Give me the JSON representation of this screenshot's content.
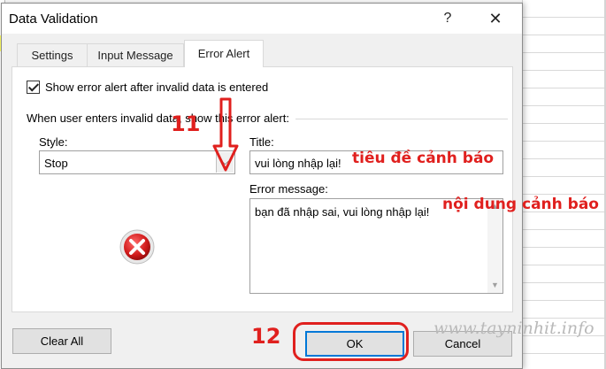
{
  "dialog": {
    "title": "Data Validation",
    "help_label": "?",
    "close_label": "✕"
  },
  "tabs": [
    {
      "label": "Settings",
      "active": false
    },
    {
      "label": "Input Message",
      "active": false
    },
    {
      "label": "Error Alert",
      "active": true
    }
  ],
  "error_alert": {
    "show_alert_label": "Show error alert after invalid data is entered",
    "show_alert_checked": true,
    "group_label": "When user enters invalid data, show this error alert:",
    "style_label": "Style:",
    "style_value": "Stop",
    "title_label": "Title:",
    "title_value": "vui lòng nhập lại!",
    "message_label": "Error message:",
    "message_value": "bạn đã nhập sai, vui lòng nhập lại!",
    "icon": "stop-error-icon"
  },
  "buttons": {
    "clear_all": "Clear All",
    "ok": "OK",
    "cancel": "Cancel"
  },
  "annotations": {
    "step_11": "11",
    "step_12": "12",
    "title_note": "tiêu đề cảnh báo",
    "message_note": "nội dung cảnh báo",
    "color": "#e0201e"
  },
  "watermark": "www.tayninhit.info"
}
